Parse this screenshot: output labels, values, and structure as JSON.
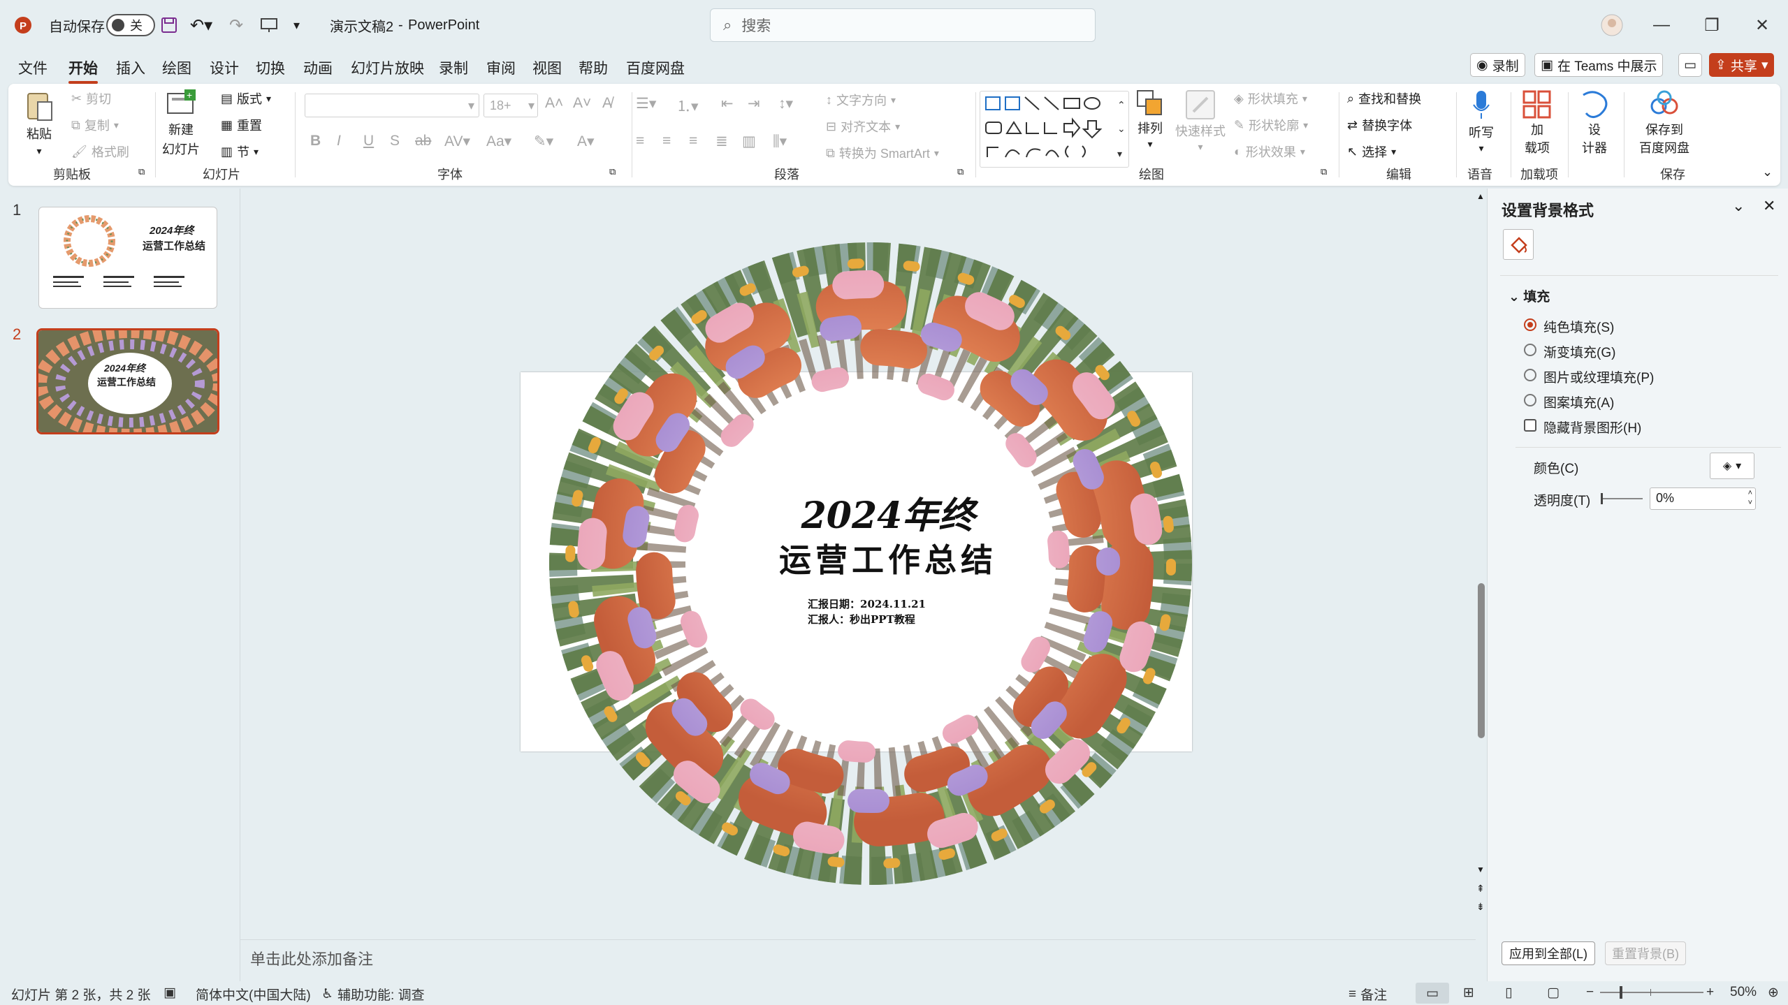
{
  "titlebar": {
    "autosave_label": "自动保存",
    "autosave_state": "关",
    "doc_title": "演示文稿2",
    "separator": "-",
    "app_name": "PowerPoint",
    "search_placeholder": "搜索"
  },
  "menu": {
    "tabs": [
      "文件",
      "开始",
      "插入",
      "绘图",
      "设计",
      "切换",
      "动画",
      "幻灯片放映",
      "录制",
      "审阅",
      "视图",
      "帮助",
      "百度网盘"
    ],
    "active": "开始",
    "record_button": "录制",
    "teams_button": "在 Teams 中展示",
    "share_button": "共享"
  },
  "ribbon": {
    "clipboard": {
      "label": "剪贴板",
      "paste": "粘贴",
      "cut": "剪切",
      "copy": "复制",
      "format_painter": "格式刷"
    },
    "slides": {
      "label": "幻灯片",
      "new_slide_line1": "新建",
      "new_slide_line2": "幻灯片",
      "layout": "版式",
      "reset": "重置",
      "section": "节"
    },
    "font": {
      "label": "字体",
      "size": "18+"
    },
    "paragraph": {
      "label": "段落",
      "text_direction": "文字方向",
      "align_text": "对齐文本",
      "convert_smartart": "转换为 SmartArt"
    },
    "drawing": {
      "label": "绘图",
      "arrange": "排列",
      "quick_styles": "快速样式",
      "shape_fill": "形状填充",
      "shape_outline": "形状轮廓",
      "shape_effects": "形状效果"
    },
    "editing": {
      "label": "编辑",
      "find_replace": "查找和替换",
      "replace_font": "替换字体",
      "select": "选择"
    },
    "voice": {
      "label": "语音",
      "dictate": "听写"
    },
    "addins": {
      "label": "加载项",
      "addins_line1": "加",
      "addins_line2": "载项"
    },
    "designer": {
      "line1": "设",
      "line2": "计器"
    },
    "save": {
      "label": "保存",
      "line1": "保存到",
      "line2": "百度网盘"
    }
  },
  "slides": {
    "items": [
      {
        "num": "1",
        "title": "2024年终",
        "subtitle": "运营工作总结"
      },
      {
        "num": "2",
        "title": "2024年终",
        "subtitle": "运营工作总结"
      }
    ]
  },
  "slide": {
    "title_line1": "2024年终",
    "title_line2": "运营工作总结",
    "info_line1": "汇报日期：2024.11.21",
    "info_line2": "汇报人：秒出PPT教程"
  },
  "notes": {
    "placeholder": "单击此处添加备注"
  },
  "format_pane": {
    "title": "设置背景格式",
    "section": "填充",
    "options": [
      "纯色填充(S)",
      "渐变填充(G)",
      "图片或纹理填充(P)",
      "图案填充(A)"
    ],
    "selected_option": "纯色填充(S)",
    "hide_bg": "隐藏背景图形(H)",
    "color_label": "颜色(C)",
    "transparency_label": "透明度(T)",
    "transparency_value": "0%",
    "apply_all": "应用到全部(L)",
    "reset_bg": "重置背景(B)"
  },
  "statusbar": {
    "slide_info": "幻灯片 第 2 张，共 2 张",
    "language": "简体中文(中国大陆)",
    "accessibility": "辅助功能: 调查",
    "notes_button": "备注",
    "zoom": "50%"
  },
  "colors": {
    "accent": "#c43e1c",
    "background": "#e6eef1",
    "ribbon": "#ffffff"
  }
}
